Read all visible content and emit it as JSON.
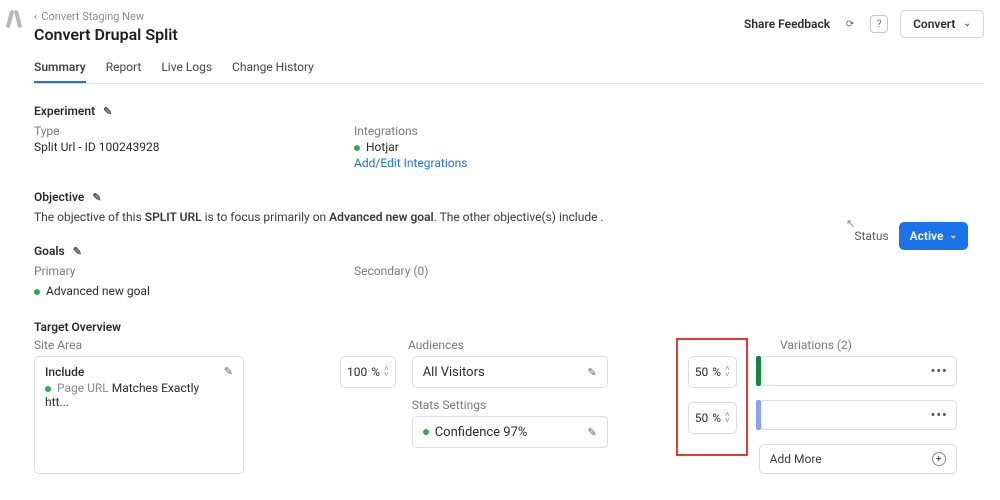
{
  "breadcrumb": "Convert Staging New",
  "page_title": "Convert Drupal Split",
  "header": {
    "share": "Share Feedback",
    "convert": "Convert"
  },
  "tabs": [
    "Summary",
    "Report",
    "Live Logs",
    "Change History"
  ],
  "experiment": {
    "heading": "Experiment",
    "type_label": "Type",
    "type_value": "Split Url - ID 100243928",
    "integ_label": "Integrations",
    "integ_value": "Hotjar",
    "integ_link": "Add/Edit Integrations",
    "status_label": "Status",
    "status_value": "Active"
  },
  "objective": {
    "heading": "Objective",
    "pre": "The objective of this ",
    "bold1": "SPLIT URL",
    "mid": " is to focus primarily on ",
    "bold2": "Advanced new goal",
    "post": ". The other objective(s) include ."
  },
  "goals": {
    "heading": "Goals",
    "primary_label": "Primary",
    "primary_value": "Advanced new goal",
    "secondary_label": "Secondary (0)"
  },
  "target": {
    "heading": "Target Overview",
    "cols": {
      "site": "Site Area",
      "aud": "Audiences",
      "var": "Variations (2)"
    },
    "include": {
      "label": "Include",
      "sub_a": "Page URL",
      "sub_b": " Matches Exactly htt..."
    },
    "pct100": "100",
    "pct_sym": "%",
    "all_visitors": "All Visitors",
    "stats_label": "Stats Settings",
    "stats_value": "Confidence 97%",
    "v1": "50",
    "v2": "50",
    "addmore": "Add More"
  }
}
